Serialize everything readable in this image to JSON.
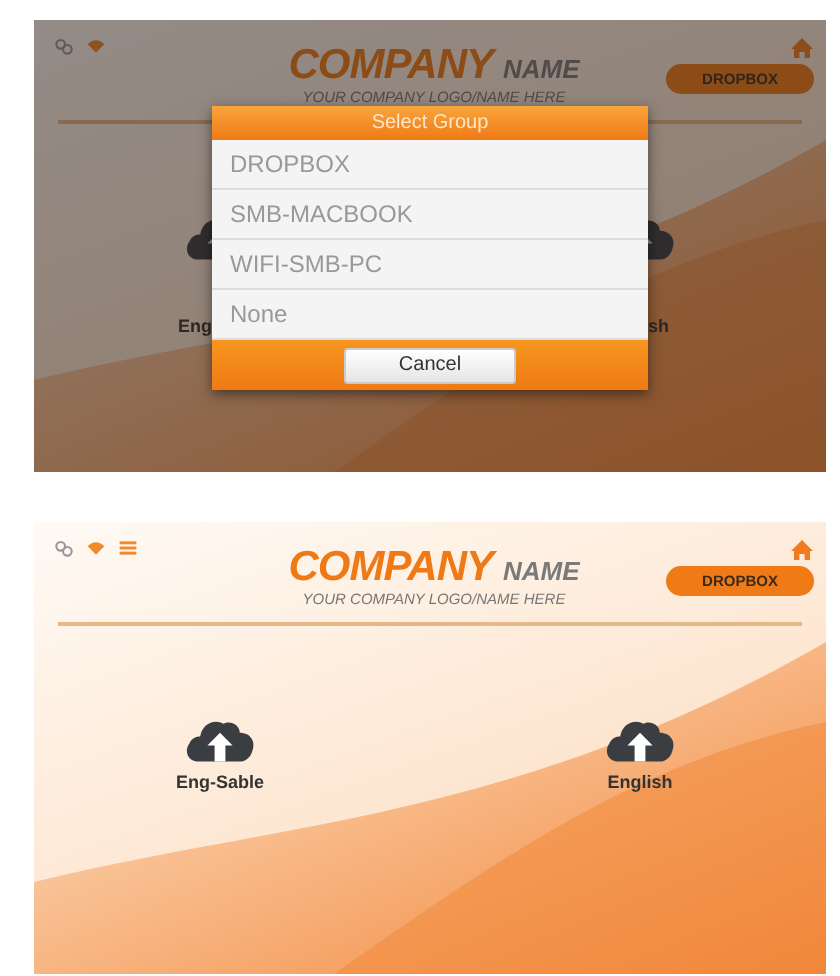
{
  "screens": [
    {
      "dimmed": true,
      "menu_icon": false,
      "header": {
        "company": "COMPANY",
        "name": "NAME",
        "tagline": "YOUR COMPANY LOGO/NAME HERE",
        "group_button": "DROPBOX"
      },
      "folders": [
        {
          "label": "Eng"
        },
        {
          "label": "sh"
        }
      ],
      "dialog": {
        "title": "Select Group",
        "options": [
          "DROPBOX",
          "SMB-MACBOOK",
          "WIFI-SMB-PC",
          "None"
        ],
        "cancel": "Cancel"
      }
    },
    {
      "dimmed": false,
      "menu_icon": true,
      "header": {
        "company": "COMPANY",
        "name": "NAME",
        "tagline": "YOUR COMPANY LOGO/NAME HERE",
        "group_button": "DROPBOX"
      },
      "folders": [
        {
          "label": "Eng-Sable"
        },
        {
          "label": "English"
        }
      ]
    }
  ]
}
